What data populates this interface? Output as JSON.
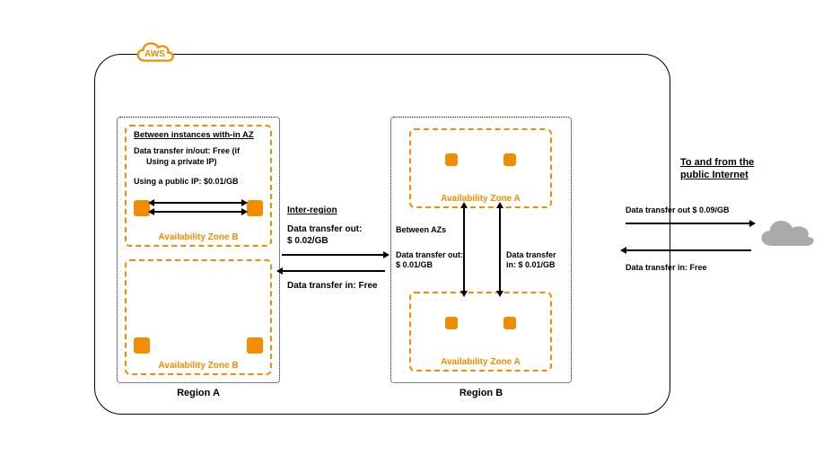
{
  "aws_label": "AWS",
  "region_a": {
    "label": "Region A",
    "az1": {
      "label": "Availability Zone B",
      "title": "Between instances with-in AZ",
      "line1": "Data transfer in/out: Free (if",
      "line2": "Using a private IP)",
      "line3": "Using a public IP: $0.01/GB"
    },
    "az2": {
      "label": "Availability Zone B"
    }
  },
  "region_b": {
    "label": "Region B",
    "az1": {
      "label": "Availability Zone A"
    },
    "az2": {
      "label": "Availability Zone A"
    }
  },
  "inter_region": {
    "title": "Inter-region",
    "out": "Data transfer out:\n$ 0.02/GB",
    "in": "Data transfer in: Free"
  },
  "between_az": {
    "title": "Between AZs",
    "out": "Data transfer out:\n$ 0.01/GB",
    "in": "Data transfer\nin: $ 0.01/GB"
  },
  "internet": {
    "title": "To and from the\npublic Internet",
    "out": "Data transfer out $ 0.09/GB",
    "in": "Data transfer in: Free"
  }
}
